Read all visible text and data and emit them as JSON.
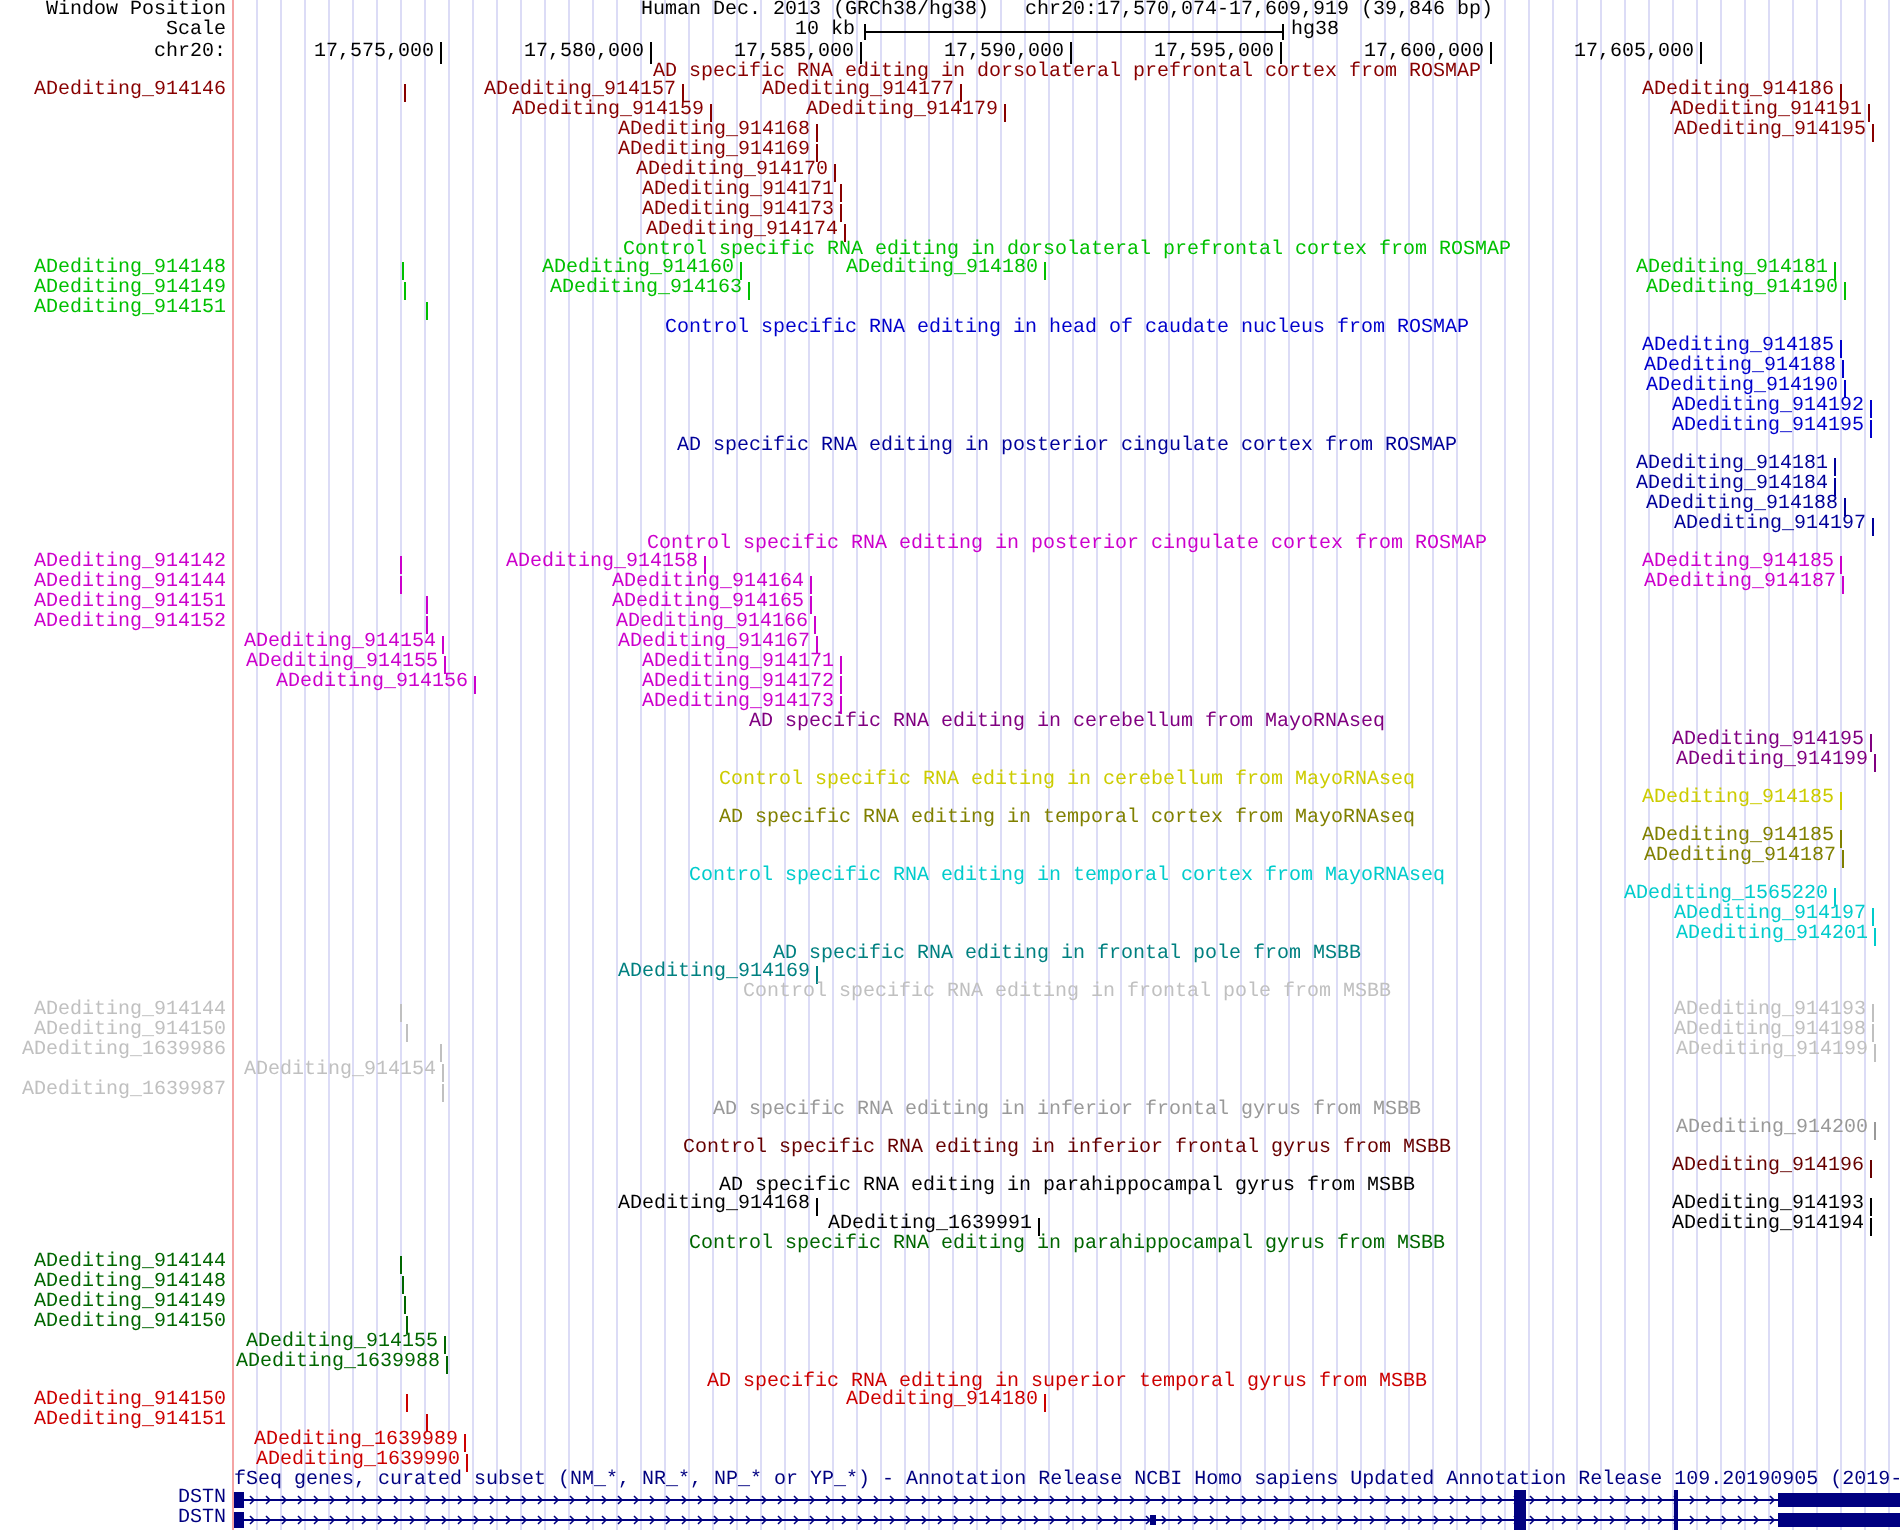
{
  "header": {
    "position_row": {
      "label": "Window Position",
      "assembly": "Human Dec. 2013 (GRCh38/hg38)",
      "position": "chr20:17,570,074-17,609,919 (39,846 bp)"
    },
    "scale_row": {
      "label": "Scale",
      "length": "10 kb",
      "assembly": "hg38"
    },
    "ruler": {
      "label": "chr20:",
      "ticks": [
        "17,575,000",
        "17,580,000",
        "17,585,000",
        "17,590,000",
        "17,595,000",
        "17,600,000",
        "17,605,000"
      ]
    }
  },
  "tracks": [
    {
      "kind": "editing",
      "title": "AD specific RNA editing in dorsolateral prefrontal cortex from ROSMAP",
      "color": "#880000",
      "rows": [
        {
          "left_label": "ADediting_914146",
          "features": [
            {
              "label": "ADediting_914157"
            },
            {
              "label": "ADediting_914177"
            },
            {
              "label": "ADediting_914186"
            }
          ]
        },
        {
          "features": [
            {
              "label": "ADediting_914159"
            },
            {
              "label": "ADediting_914179"
            },
            {
              "label": "ADediting_914191"
            }
          ]
        },
        {
          "features": [
            {
              "label": "ADediting_914168"
            },
            {
              "label": "ADediting_914195"
            }
          ]
        },
        {
          "features": [
            {
              "label": "ADediting_914169"
            }
          ]
        },
        {
          "features": [
            {
              "label": "ADediting_914170"
            }
          ]
        },
        {
          "features": [
            {
              "label": "ADediting_914171"
            }
          ]
        },
        {
          "features": [
            {
              "label": "ADediting_914173"
            }
          ]
        },
        {
          "features": [
            {
              "label": "ADediting_914174"
            }
          ]
        }
      ]
    },
    {
      "kind": "editing",
      "title": "Control specific RNA editing in dorsolateral prefrontal cortex from ROSMAP",
      "color": "#00c000",
      "rows": [
        {
          "left_label": "ADediting_914148",
          "features": [
            {
              "label": "ADediting_914160"
            },
            {
              "label": "ADediting_914180"
            },
            {
              "label": "ADediting_914181"
            }
          ]
        },
        {
          "left_label": "ADediting_914149",
          "features": [
            {
              "label": "ADediting_914163"
            },
            {
              "label": "ADediting_914190"
            }
          ]
        },
        {
          "left_label": "ADediting_914151"
        }
      ]
    },
    {
      "kind": "editing",
      "title": "Control specific RNA editing in head of caudate nucleus from ROSMAP",
      "color": "#0000cc",
      "rows": [
        {
          "features": [
            {
              "label": "ADediting_914185"
            }
          ]
        },
        {
          "features": [
            {
              "label": "ADediting_914188"
            }
          ]
        },
        {
          "features": [
            {
              "label": "ADediting_914190"
            }
          ]
        },
        {
          "features": [
            {
              "label": "ADediting_914192"
            }
          ]
        },
        {
          "features": [
            {
              "label": "ADediting_914195"
            }
          ]
        }
      ]
    },
    {
      "kind": "editing",
      "title": "AD specific RNA editing in posterior cingulate cortex from ROSMAP",
      "color": "#000099",
      "rows": [
        {
          "features": [
            {
              "label": "ADediting_914181"
            }
          ]
        },
        {
          "features": [
            {
              "label": "ADediting_914184"
            }
          ]
        },
        {
          "features": [
            {
              "label": "ADediting_914188"
            }
          ]
        },
        {
          "features": [
            {
              "label": "ADediting_914197"
            }
          ]
        }
      ]
    },
    {
      "kind": "editing",
      "title": "Control specific RNA editing in posterior cingulate cortex from ROSMAP",
      "color": "#cc00cc",
      "rows": [
        {
          "left_label": "ADediting_914142",
          "features": [
            {
              "label": "ADediting_914158"
            },
            {
              "label": "ADediting_914185"
            }
          ]
        },
        {
          "left_label": "ADediting_914144",
          "features": [
            {
              "label": "ADediting_914164"
            },
            {
              "label": "ADediting_914187"
            }
          ]
        },
        {
          "left_label": "ADediting_914151",
          "features": [
            {
              "label": "ADediting_914165"
            }
          ]
        },
        {
          "left_label": "ADediting_914152",
          "features": [
            {
              "label": "ADediting_914166"
            }
          ]
        },
        {
          "features": [
            {
              "label": "ADediting_914154"
            },
            {
              "label": "ADediting_914167"
            }
          ]
        },
        {
          "features": [
            {
              "label": "ADediting_914155"
            },
            {
              "label": "ADediting_914171"
            }
          ]
        },
        {
          "features": [
            {
              "label": "ADediting_914156"
            },
            {
              "label": "ADediting_914172"
            }
          ]
        },
        {
          "features": [
            {
              "label": "ADediting_914173"
            }
          ]
        }
      ]
    },
    {
      "kind": "editing",
      "title": "AD specific RNA editing in cerebellum from MayoRNAseq",
      "color": "#800080",
      "rows": [
        {
          "features": [
            {
              "label": "ADediting_914195"
            }
          ]
        },
        {
          "features": [
            {
              "label": "ADediting_914199"
            }
          ]
        }
      ]
    },
    {
      "kind": "editing",
      "title": "Control specific RNA editing in cerebellum from MayoRNAseq",
      "color": "#cccc00",
      "rows": [
        {
          "features": [
            {
              "label": "ADediting_914185"
            }
          ]
        }
      ]
    },
    {
      "kind": "editing",
      "title": "AD specific RNA editing in temporal cortex from MayoRNAseq",
      "color": "#808000",
      "rows": [
        {
          "features": [
            {
              "label": "ADediting_914185"
            }
          ]
        },
        {
          "features": [
            {
              "label": "ADediting_914187"
            }
          ]
        }
      ]
    },
    {
      "kind": "editing",
      "title": "Control specific RNA editing in temporal cortex from MayoRNAseq",
      "color": "#00cccc",
      "rows": [
        {
          "features": [
            {
              "label": "ADediting_1565220"
            }
          ]
        },
        {
          "features": [
            {
              "label": "ADediting_914197"
            }
          ]
        },
        {
          "features": [
            {
              "label": "ADediting_914201"
            }
          ]
        }
      ]
    },
    {
      "kind": "editing",
      "title": "AD specific RNA editing in frontal pole from MSBB",
      "color": "#008080",
      "rows": [
        {
          "features": [
            {
              "label": "ADediting_914169"
            }
          ]
        }
      ]
    },
    {
      "kind": "editing",
      "title": "Control specific RNA editing in frontal pole from MSBB",
      "color": "#c0c0c0",
      "rows": [
        {
          "left_label": "ADediting_914144",
          "features": [
            {
              "label": "ADediting_914193"
            }
          ]
        },
        {
          "left_label": "ADediting_914150",
          "features": [
            {
              "label": "ADediting_914198"
            }
          ]
        },
        {
          "left_label": "ADediting_1639986",
          "features": [
            {
              "label": "ADediting_914199"
            }
          ]
        },
        {
          "features": [
            {
              "label": "ADediting_914154"
            }
          ]
        },
        {
          "left_label": "ADediting_1639987"
        }
      ]
    },
    {
      "kind": "editing",
      "title": "AD specific RNA editing in inferior frontal gyrus from MSBB",
      "color": "#999999",
      "rows": [
        {
          "features": [
            {
              "label": "ADediting_914200"
            }
          ]
        }
      ]
    },
    {
      "kind": "editing",
      "title": "Control specific RNA editing in inferior frontal gyrus from MSBB",
      "color": "#660000",
      "rows": [
        {
          "features": [
            {
              "label": "ADediting_914196"
            }
          ]
        }
      ]
    },
    {
      "kind": "editing",
      "title": "AD specific RNA editing in parahippocampal gyrus from MSBB",
      "color": "#000000",
      "rows": [
        {
          "features": [
            {
              "label": "ADediting_914168"
            },
            {
              "label": "ADediting_914193"
            }
          ]
        },
        {
          "features": [
            {
              "label": "ADediting_1639991"
            },
            {
              "label": "ADediting_914194"
            }
          ]
        }
      ]
    },
    {
      "kind": "editing",
      "title": "Control specific RNA editing in parahippocampal gyrus from MSBB",
      "color": "#006600",
      "rows": [
        {
          "left_label": "ADediting_914144"
        },
        {
          "left_label": "ADediting_914148"
        },
        {
          "left_label": "ADediting_914149"
        },
        {
          "left_label": "ADediting_914150"
        },
        {
          "features": [
            {
              "label": "ADediting_914155"
            }
          ]
        },
        {
          "features": [
            {
              "label": "ADediting_1639988"
            }
          ]
        }
      ]
    },
    {
      "kind": "editing",
      "title": "AD specific RNA editing in superior temporal gyrus from MSBB",
      "color": "#cc0000",
      "rows": [
        {
          "left_label": "ADediting_914150",
          "features": [
            {
              "label": "ADediting_914180"
            }
          ]
        },
        {
          "left_label": "ADediting_914151"
        },
        {
          "features": [
            {
              "label": "ADediting_1639989"
            }
          ]
        },
        {
          "features": [
            {
              "label": "ADediting_1639990"
            }
          ]
        }
      ]
    },
    {
      "kind": "genes",
      "title": "fSeq genes, curated subset (NM_*, NR_*, NP_* or YP_*) - Annotation Release NCBI Homo sapiens Updated Annotation Release 109.20190905 (2019-",
      "color": "#000080",
      "rows": [
        {
          "label": "DSTN"
        },
        {
          "label": "DSTN"
        }
      ]
    }
  ]
}
